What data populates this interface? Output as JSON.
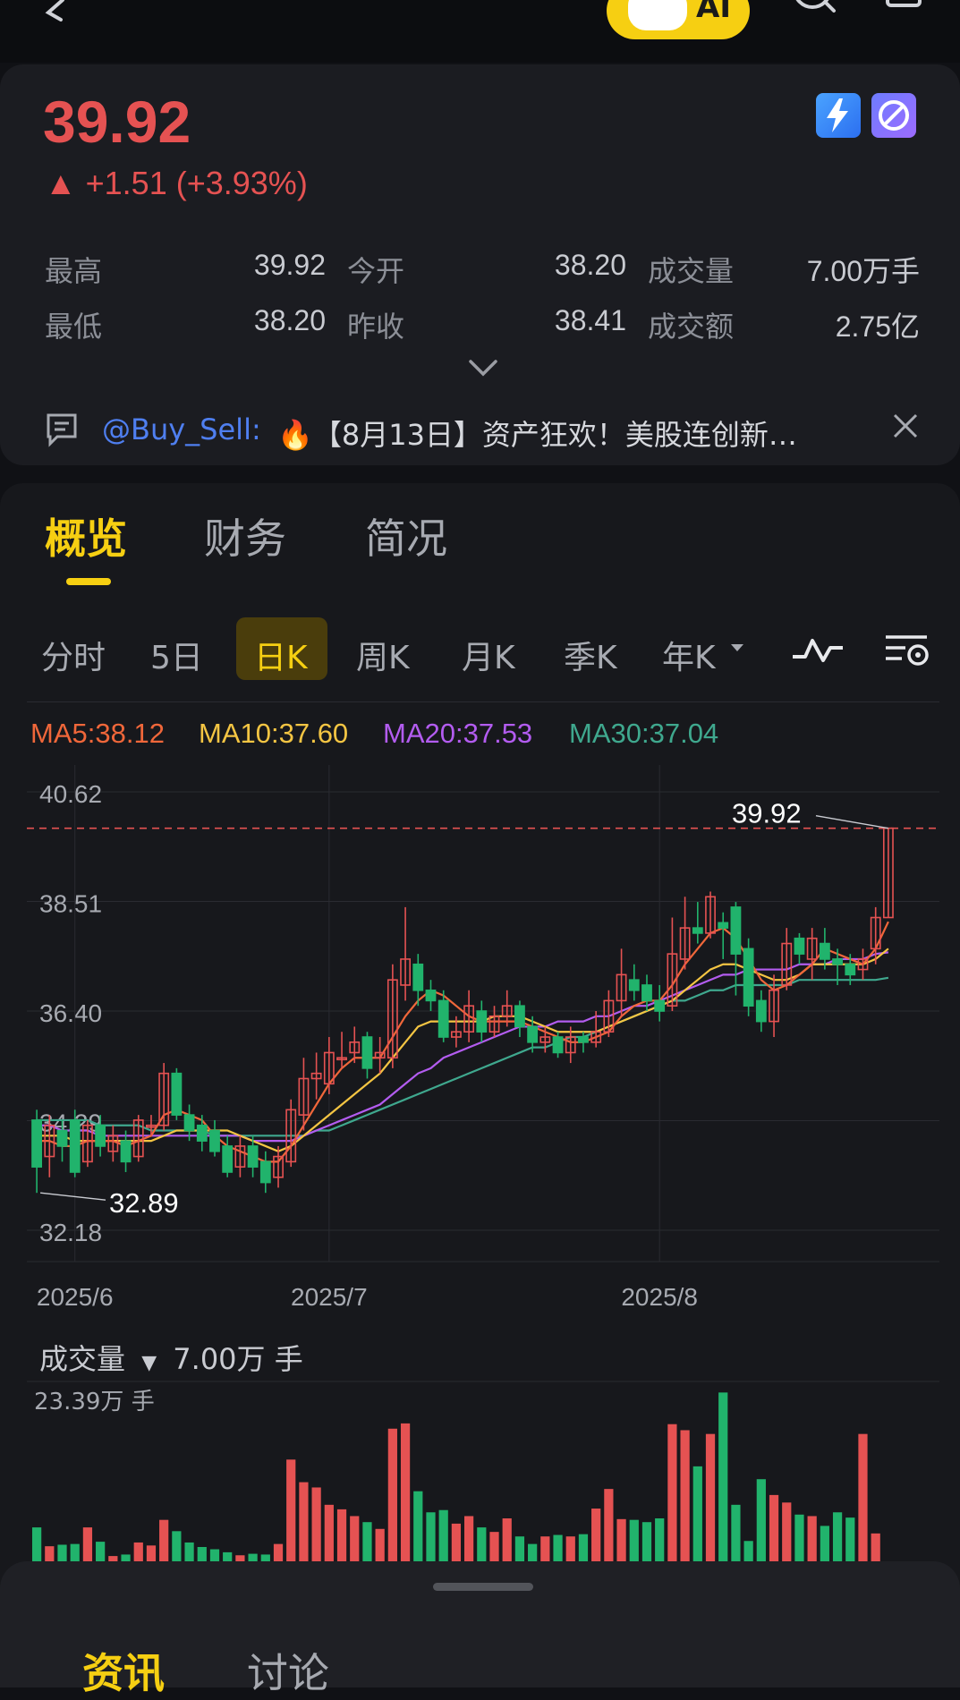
{
  "header": {
    "title": "",
    "ai_label": "AI"
  },
  "quote": {
    "price": "39.92",
    "change": "▲ +1.51 (+3.93%)",
    "stats": [
      {
        "label": "最高",
        "value": "39.92"
      },
      {
        "label": "今开",
        "value": "38.20"
      },
      {
        "label": "成交量",
        "value": "7.00万手"
      },
      {
        "label": "最低",
        "value": "38.20"
      },
      {
        "label": "昨收",
        "value": "38.41"
      },
      {
        "label": "成交额",
        "value": "2.75亿"
      }
    ],
    "badges": [
      "lightning-1-badge",
      "no-margin-badge"
    ]
  },
  "news": {
    "user": "@Buy_Sell:",
    "text": "🔥【8月13日】资产狂欢！美股连创新…"
  },
  "tabs": [
    {
      "label": "概览",
      "active": true
    },
    {
      "label": "财务",
      "active": false
    },
    {
      "label": "简况",
      "active": false
    }
  ],
  "periods": [
    {
      "label": "分时",
      "active": false
    },
    {
      "label": "5日",
      "active": false
    },
    {
      "label": "日K",
      "active": true
    },
    {
      "label": "周K",
      "active": false
    },
    {
      "label": "月K",
      "active": false
    },
    {
      "label": "季K",
      "active": false
    },
    {
      "label": "年K",
      "active": false
    }
  ],
  "ma": {
    "ma5": "MA5:38.12",
    "ma10": "MA10:37.60",
    "ma20": "MA20:37.53",
    "ma30": "MA30:37.04"
  },
  "colors": {
    "up": "#e55252",
    "down": "#21b36c",
    "ma5": "#f0673a",
    "ma10": "#f4c543",
    "ma20": "#b35cf0",
    "ma30": "#3fa88e",
    "accent": "#f6cf12"
  },
  "volume": {
    "label": "成交量",
    "value": "7.00万 手",
    "max_label": "23.39万 手"
  },
  "chart_data": {
    "type": "candlestick",
    "y_ticks": [
      "40.62",
      "38.51",
      "36.40",
      "34.29",
      "32.18"
    ],
    "ylim": [
      32.18,
      40.62
    ],
    "x_ticks": [
      {
        "label": "2025/6",
        "index": 3
      },
      {
        "label": "2025/7",
        "index": 23
      },
      {
        "label": "2025/8",
        "index": 49
      }
    ],
    "high_label": "39.92",
    "low_label": "32.89",
    "last_price_line": 39.92,
    "candles": [
      [
        34.3,
        33.4,
        34.5,
        32.9
      ],
      [
        33.6,
        34.2,
        34.4,
        33.2
      ],
      [
        34.1,
        33.8,
        34.3,
        33.5
      ],
      [
        34.3,
        33.3,
        34.5,
        33.2
      ],
      [
        33.5,
        34.2,
        34.3,
        33.4
      ],
      [
        34.2,
        33.8,
        34.4,
        33.6
      ],
      [
        33.7,
        34.0,
        34.2,
        33.5
      ],
      [
        33.9,
        33.5,
        34.1,
        33.3
      ],
      [
        33.6,
        34.3,
        34.4,
        33.5
      ],
      [
        34.2,
        34.2,
        34.4,
        34.0
      ],
      [
        34.2,
        35.2,
        35.4,
        34.1
      ],
      [
        35.2,
        34.4,
        35.3,
        34.3
      ],
      [
        34.4,
        34.1,
        34.6,
        33.9
      ],
      [
        34.2,
        33.9,
        34.4,
        33.7
      ],
      [
        34.1,
        33.7,
        34.3,
        33.6
      ],
      [
        33.8,
        33.3,
        34.0,
        33.2
      ],
      [
        33.4,
        33.8,
        34.0,
        33.2
      ],
      [
        33.8,
        33.4,
        34.0,
        33.2
      ],
      [
        33.5,
        33.1,
        33.7,
        32.9
      ],
      [
        33.2,
        33.6,
        33.8,
        33.0
      ],
      [
        33.5,
        34.5,
        34.7,
        33.4
      ],
      [
        34.4,
        35.1,
        35.5,
        34.1
      ],
      [
        35.1,
        35.2,
        35.6,
        34.7
      ],
      [
        35.0,
        35.6,
        35.9,
        34.8
      ],
      [
        35.5,
        35.5,
        36.0,
        35.3
      ],
      [
        35.6,
        35.8,
        36.1,
        35.4
      ],
      [
        35.9,
        35.3,
        36.0,
        35.1
      ],
      [
        35.5,
        35.6,
        35.9,
        35.2
      ],
      [
        35.5,
        37.0,
        37.3,
        35.3
      ],
      [
        36.9,
        37.4,
        38.4,
        36.6
      ],
      [
        37.3,
        36.8,
        37.5,
        36.5
      ],
      [
        36.8,
        36.6,
        37.0,
        36.4
      ],
      [
        36.6,
        35.9,
        36.8,
        35.8
      ],
      [
        35.9,
        36.0,
        36.3,
        35.7
      ],
      [
        36.0,
        36.5,
        36.8,
        35.8
      ],
      [
        36.4,
        36.0,
        36.6,
        35.8
      ],
      [
        36.0,
        36.3,
        36.5,
        35.9
      ],
      [
        36.3,
        36.5,
        36.8,
        36.1
      ],
      [
        36.5,
        36.1,
        36.6,
        35.9
      ],
      [
        36.1,
        35.8,
        36.3,
        35.6
      ],
      [
        35.8,
        35.9,
        36.1,
        35.6
      ],
      [
        35.9,
        35.6,
        36.0,
        35.5
      ],
      [
        35.6,
        35.9,
        36.1,
        35.4
      ],
      [
        35.9,
        35.8,
        36.0,
        35.6
      ],
      [
        35.8,
        36.0,
        36.4,
        35.7
      ],
      [
        36.0,
        36.6,
        36.8,
        35.9
      ],
      [
        36.6,
        37.1,
        37.6,
        36.3
      ],
      [
        37.0,
        36.8,
        37.3,
        36.6
      ],
      [
        36.9,
        36.6,
        37.1,
        36.4
      ],
      [
        36.6,
        36.4,
        36.9,
        36.2
      ],
      [
        36.5,
        37.5,
        38.2,
        36.4
      ],
      [
        37.4,
        38.0,
        38.6,
        37.2
      ],
      [
        38.0,
        37.9,
        38.5,
        37.7
      ],
      [
        37.9,
        38.6,
        38.7,
        37.8
      ],
      [
        38.1,
        38.0,
        38.3,
        37.4
      ],
      [
        38.4,
        37.5,
        38.5,
        36.7
      ],
      [
        37.6,
        36.5,
        37.8,
        36.3
      ],
      [
        36.6,
        36.2,
        36.8,
        36.0
      ],
      [
        36.2,
        36.8,
        37.1,
        35.9
      ],
      [
        36.9,
        37.7,
        38.0,
        36.8
      ],
      [
        37.8,
        37.5,
        37.9,
        37.3
      ],
      [
        37.4,
        37.8,
        38.0,
        37.0
      ],
      [
        37.7,
        37.4,
        38.0,
        37.2
      ],
      [
        37.4,
        37.3,
        37.6,
        36.9
      ],
      [
        37.3,
        37.1,
        37.5,
        36.9
      ],
      [
        37.2,
        37.4,
        37.6,
        37.0
      ],
      [
        37.6,
        38.2,
        38.4,
        37.3
      ],
      [
        38.2,
        39.92,
        39.92,
        38.2
      ]
    ],
    "ma5": [
      33.9,
      33.9,
      33.8,
      33.8,
      33.9,
      33.9,
      33.9,
      33.8,
      33.9,
      34.0,
      34.4,
      34.5,
      34.4,
      34.3,
      34.0,
      33.8,
      33.7,
      33.6,
      33.5,
      33.5,
      33.8,
      34.2,
      34.6,
      35.0,
      35.3,
      35.5,
      35.5,
      35.5,
      35.9,
      36.3,
      36.6,
      36.8,
      36.7,
      36.5,
      36.3,
      36.2,
      36.2,
      36.2,
      36.2,
      36.1,
      36.0,
      35.9,
      35.8,
      35.8,
      35.9,
      36.0,
      36.3,
      36.5,
      36.6,
      36.6,
      36.9,
      37.3,
      37.6,
      37.9,
      38.0,
      37.8,
      37.4,
      37.0,
      36.8,
      36.9,
      37.1,
      37.3,
      37.6,
      37.5,
      37.4,
      37.3,
      37.6,
      38.12
    ],
    "ma10": [
      34.0,
      34.0,
      34.0,
      33.9,
      33.9,
      33.9,
      33.9,
      33.9,
      33.9,
      33.9,
      34.0,
      34.1,
      34.1,
      34.1,
      34.1,
      34.1,
      34.0,
      33.9,
      33.8,
      33.7,
      33.8,
      34.0,
      34.2,
      34.4,
      34.6,
      34.8,
      35.0,
      35.2,
      35.5,
      35.8,
      36.1,
      36.2,
      36.2,
      36.2,
      36.2,
      36.2,
      36.3,
      36.3,
      36.3,
      36.2,
      36.1,
      36.0,
      36.0,
      36.0,
      36.0,
      36.1,
      36.2,
      36.3,
      36.4,
      36.5,
      36.6,
      36.8,
      37.0,
      37.2,
      37.3,
      37.3,
      37.2,
      37.1,
      37.0,
      37.0,
      37.1,
      37.3,
      37.3,
      37.3,
      37.3,
      37.3,
      37.4,
      37.6
    ],
    "ma20": [
      34.2,
      34.2,
      34.1,
      34.1,
      34.1,
      34.0,
      34.0,
      34.0,
      34.0,
      34.0,
      34.0,
      34.0,
      34.0,
      34.0,
      34.0,
      34.0,
      34.0,
      33.9,
      33.9,
      33.9,
      33.9,
      34.0,
      34.1,
      34.2,
      34.3,
      34.4,
      34.5,
      34.6,
      34.8,
      35.0,
      35.2,
      35.3,
      35.5,
      35.6,
      35.7,
      35.8,
      35.9,
      36.0,
      36.1,
      36.1,
      36.1,
      36.2,
      36.2,
      36.2,
      36.3,
      36.3,
      36.4,
      36.5,
      36.5,
      36.6,
      36.7,
      36.8,
      36.9,
      37.0,
      37.1,
      37.1,
      37.2,
      37.2,
      37.2,
      37.2,
      37.3,
      37.3,
      37.3,
      37.4,
      37.4,
      37.4,
      37.5,
      37.53
    ],
    "ma30": [
      34.3,
      34.3,
      34.3,
      34.3,
      34.3,
      34.2,
      34.2,
      34.2,
      34.2,
      34.1,
      34.1,
      34.1,
      34.1,
      34.1,
      34.0,
      34.0,
      34.0,
      34.0,
      34.0,
      34.0,
      34.0,
      34.0,
      34.1,
      34.1,
      34.2,
      34.3,
      34.4,
      34.5,
      34.6,
      34.7,
      34.8,
      34.9,
      35.0,
      35.1,
      35.2,
      35.3,
      35.4,
      35.5,
      35.6,
      35.7,
      35.7,
      35.8,
      35.9,
      35.9,
      36.0,
      36.1,
      36.2,
      36.3,
      36.4,
      36.5,
      36.6,
      36.6,
      36.7,
      36.8,
      36.8,
      36.9,
      36.9,
      36.9,
      36.9,
      36.9,
      37.0,
      37.0,
      37.0,
      37.0,
      37.0,
      37.0,
      37.0,
      37.04
    ],
    "volume_ylim": [
      0,
      23.39
    ],
    "volume": [
      4.5,
      2.0,
      2.2,
      2.3,
      4.5,
      2.6,
      0.7,
      0.9,
      2.5,
      2.1,
      5.5,
      4.0,
      2.5,
      1.9,
      1.6,
      1.2,
      0.8,
      1.0,
      0.9,
      2.3,
      13.5,
      10.5,
      9.8,
      7.5,
      6.9,
      6.0,
      5.2,
      4.3,
      17.6,
      18.3,
      9.3,
      6.5,
      6.8,
      5.0,
      6.0,
      4.5,
      3.9,
      5.7,
      3.3,
      2.3,
      3.3,
      3.5,
      3.3,
      3.6,
      7.0,
      9.6,
      5.6,
      5.5,
      5.2,
      5.7,
      18.2,
      17.4,
      12.6,
      16.9,
      22.4,
      7.5,
      2.7,
      10.9,
      8.8,
      7.8,
      6.2,
      6.0,
      4.7,
      6.5,
      5.8,
      16.9,
      3.7
    ]
  },
  "sheet_tabs": [
    {
      "label": "资讯",
      "active": true
    },
    {
      "label": "讨论",
      "active": false
    }
  ]
}
